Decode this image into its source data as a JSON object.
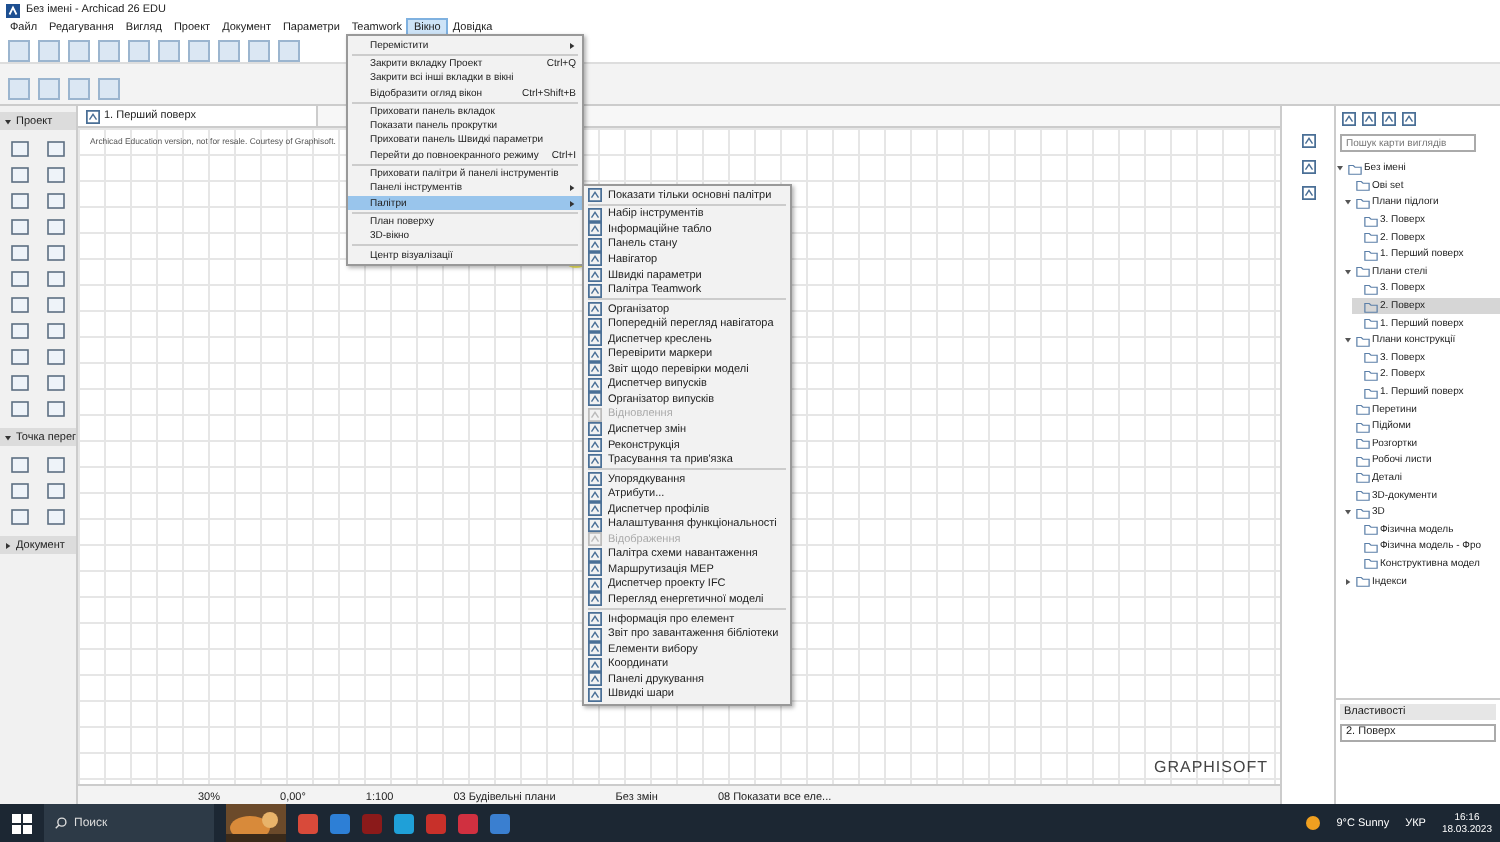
{
  "window": {
    "title": "Без імені - Archicad 26 EDU"
  },
  "menu_bar": [
    {
      "label": "Файл",
      "selected": false
    },
    {
      "label": "Редагування",
      "selected": false
    },
    {
      "label": "Вигляд",
      "selected": false
    },
    {
      "label": "Проект",
      "selected": false
    },
    {
      "label": "Документ",
      "selected": false
    },
    {
      "label": "Параметри",
      "selected": false
    },
    {
      "label": "Teamwork",
      "selected": false
    },
    {
      "label": "Вікно",
      "selected": true
    },
    {
      "label": "Довідка",
      "selected": false
    }
  ],
  "toolbox": {
    "sections": [
      {
        "title": "Проект",
        "expanded": true
      },
      {
        "title": "Точка перег",
        "expanded": true
      },
      {
        "title": "Документ",
        "expanded": false
      }
    ]
  },
  "view_tab": {
    "label": "1. Перший поверх"
  },
  "canvas": {
    "notice": "Archicad Education version, not for resale. Courtesy of Graphisoft.",
    "brand": "GRAPHISOFT"
  },
  "status_bar": [
    {
      "text": "30%"
    },
    {
      "text": "0,00°"
    },
    {
      "text": "1:100"
    },
    {
      "text": "03 Будівельні плани"
    },
    {
      "text": "Без змін"
    },
    {
      "text": "08 Показати все еле..."
    }
  ],
  "window_menu": {
    "items": [
      {
        "kind": "item",
        "label": "Перемістити",
        "submenu": true,
        "selected": false
      },
      {
        "kind": "separator"
      },
      {
        "kind": "item",
        "label": "Закрити вкладку Проект",
        "shortcut": "Ctrl+Q",
        "submenu": false,
        "selected": false
      },
      {
        "kind": "item",
        "label": "Закрити всі інші вкладки в вікні",
        "submenu": false,
        "selected": false
      },
      {
        "kind": "item",
        "label": "Відобразити огляд вікон",
        "shortcut": "Ctrl+Shift+B",
        "submenu": false,
        "selected": false
      },
      {
        "kind": "separator"
      },
      {
        "kind": "item",
        "label": "Приховати панель вкладок",
        "submenu": false,
        "selected": false
      },
      {
        "kind": "item",
        "label": "Показати панель прокрутки",
        "submenu": false,
        "selected": false
      },
      {
        "kind": "item",
        "label": "Приховати панель Швидкі параметри",
        "submenu": false,
        "selected": false
      },
      {
        "kind": "item",
        "label": "Перейти до повноекранного режиму",
        "shortcut": "Ctrl+I",
        "submenu": false,
        "selected": false
      },
      {
        "kind": "separator"
      },
      {
        "kind": "item",
        "label": "Приховати палітри й панелі інструментів",
        "submenu": false,
        "selected": false
      },
      {
        "kind": "item",
        "label": "Панелі інструментів",
        "submenu": true,
        "selected": false
      },
      {
        "kind": "item",
        "label": "Палітри",
        "submenu": true,
        "selected": true
      },
      {
        "kind": "separator"
      },
      {
        "kind": "item",
        "label": "План поверху",
        "submenu": false,
        "selected": false
      },
      {
        "kind": "item",
        "label": "3D-вікно",
        "submenu": false,
        "selected": false
      },
      {
        "kind": "separator"
      },
      {
        "kind": "item",
        "label": "Центр візуалізації",
        "submenu": false,
        "selected": false
      }
    ]
  },
  "palettes_submenu": {
    "items": [
      {
        "kind": "item",
        "label": "Показати тільки основні палітри",
        "disabled": false
      },
      {
        "kind": "separator"
      },
      {
        "kind": "item",
        "label": "Набір інструментів",
        "disabled": false
      },
      {
        "kind": "item",
        "label": "Інформаційне табло",
        "disabled": false
      },
      {
        "kind": "item",
        "label": "Панель стану",
        "disabled": false
      },
      {
        "kind": "item",
        "label": "Навігатор",
        "disabled": false
      },
      {
        "kind": "item",
        "label": "Швидкі параметри",
        "disabled": false
      },
      {
        "kind": "item",
        "label": "Палітра Teamwork",
        "disabled": false
      },
      {
        "kind": "separator"
      },
      {
        "kind": "item",
        "label": "Організатор",
        "disabled": false
      },
      {
        "kind": "item",
        "label": "Попередній перегляд навігатора",
        "disabled": false
      },
      {
        "kind": "item",
        "label": "Диспетчер креслень",
        "disabled": false
      },
      {
        "kind": "item",
        "label": "Перевірити маркери",
        "disabled": false
      },
      {
        "kind": "item",
        "label": "Звіт щодо перевірки моделі",
        "disabled": false
      },
      {
        "kind": "item",
        "label": "Диспетчер випусків",
        "disabled": false
      },
      {
        "kind": "item",
        "label": "Організатор випусків",
        "disabled": false
      },
      {
        "kind": "item",
        "label": "Відновлення",
        "disabled": true
      },
      {
        "kind": "item",
        "label": "Диспетчер змін",
        "disabled": false
      },
      {
        "kind": "item",
        "label": "Реконструкція",
        "disabled": false
      },
      {
        "kind": "item",
        "label": "Трасування та прив'язка",
        "disabled": false
      },
      {
        "kind": "separator"
      },
      {
        "kind": "item",
        "label": "Упорядкування",
        "disabled": false
      },
      {
        "kind": "item",
        "label": "Атрибути...",
        "disabled": false
      },
      {
        "kind": "item",
        "label": "Диспетчер профілів",
        "disabled": false
      },
      {
        "kind": "item",
        "label": "Налаштування функціональності",
        "disabled": false
      },
      {
        "kind": "item",
        "label": "Відображення",
        "disabled": true
      },
      {
        "kind": "item",
        "label": "Палітра схеми навантаження",
        "disabled": false
      },
      {
        "kind": "item",
        "label": "Маршрутизація MEP",
        "disabled": false
      },
      {
        "kind": "item",
        "label": "Диспетчер проекту IFC",
        "disabled": false
      },
      {
        "kind": "item",
        "label": "Перегляд енергетичної моделі",
        "disabled": false
      },
      {
        "kind": "separator"
      },
      {
        "kind": "item",
        "label": "Інформація про елемент",
        "disabled": false
      },
      {
        "kind": "item",
        "label": "Звіт про завантаження бібліотеки",
        "disabled": false
      },
      {
        "kind": "item",
        "label": "Елементи вибору",
        "disabled": false
      },
      {
        "kind": "item",
        "label": "Координати",
        "disabled": false
      },
      {
        "kind": "item",
        "label": "Панелі друкування",
        "disabled": false
      },
      {
        "kind": "item",
        "label": "Швидкі шари",
        "disabled": false
      }
    ]
  },
  "navigator": {
    "search": {
      "placeholder": "Пошук карти виглядів"
    },
    "tree": [
      {
        "label": "Без імені",
        "expanded": true,
        "selected": false,
        "children": [
          {
            "label": "Ові set",
            "selected": false
          },
          {
            "label": "Плани підлоги",
            "expanded": true,
            "selected": false,
            "children": [
              {
                "label": "3. Поверх",
                "selected": false
              },
              {
                "label": "2. Поверх",
                "selected": false
              },
              {
                "label": "1. Перший поверх",
                "selected": false
              }
            ]
          },
          {
            "label": "Плани стелі",
            "expanded": true,
            "selected": false,
            "children": [
              {
                "label": "3. Поверх",
                "selected": false
              },
              {
                "label": "2. Поверх",
                "selected": true
              },
              {
                "label": "1. Перший поверх",
                "selected": false
              }
            ]
          },
          {
            "label": "Плани конструкції",
            "expanded": true,
            "selected": false,
            "children": [
              {
                "label": "3. Поверх",
                "selected": false
              },
              {
                "label": "2. Поверх",
                "selected": false
              },
              {
                "label": "1. Перший поверх",
                "selected": false
              }
            ]
          },
          {
            "label": "Перетини",
            "selected": false
          },
          {
            "label": "Підйоми",
            "selected": false
          },
          {
            "label": "Розгортки",
            "selected": false
          },
          {
            "label": "Робочі листи",
            "selected": false
          },
          {
            "label": "Деталі",
            "selected": false
          },
          {
            "label": "3D-документи",
            "selected": false
          },
          {
            "label": "3D",
            "expanded": true,
            "selected": false,
            "children": [
              {
                "label": "Фізична модель",
                "selected": false
              },
              {
                "label": "Фізична модель - Фро",
                "selected": false
              },
              {
                "label": "Конструктивна модел",
                "selected": false
              }
            ]
          },
          {
            "label": "Індекси",
            "expanded": false,
            "selected": false
          }
        ]
      }
    ]
  },
  "properties": {
    "title": "Властивості",
    "story": "2. Поверх"
  },
  "taskbar": {
    "search_placeholder": "Поиск",
    "weather": "9°C Sunny",
    "language": "УКР",
    "time": "16:16",
    "date": "18.03.2023"
  }
}
